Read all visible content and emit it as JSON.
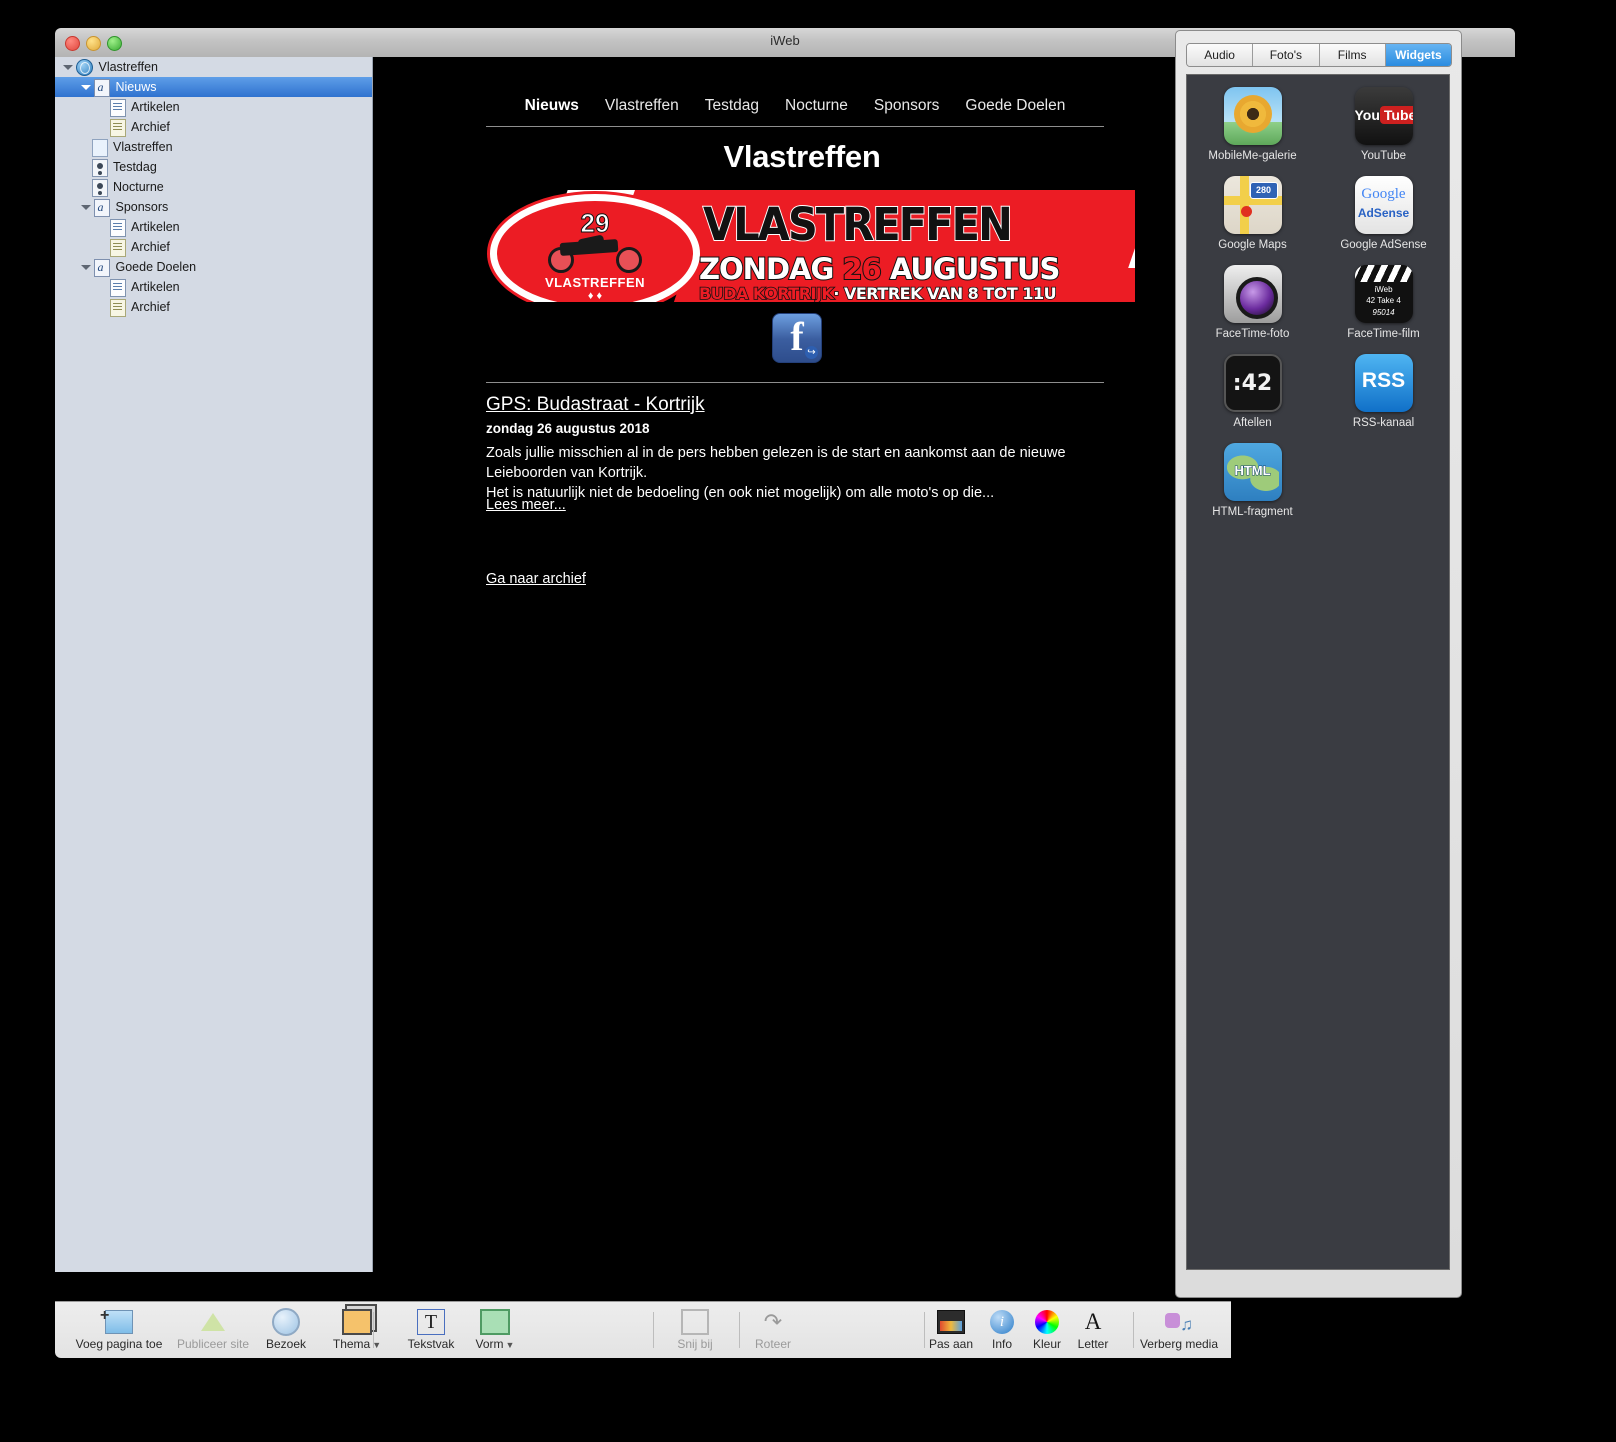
{
  "window": {
    "title": "iWeb",
    "traffic_lights": [
      "close-button",
      "minimize-button",
      "zoom-button"
    ]
  },
  "sidebar": {
    "items": [
      {
        "label": "Vlastreffen",
        "icon": "globe-icon",
        "depth": 0,
        "disclosure": "open",
        "selected": false
      },
      {
        "label": "Nieuws",
        "icon": "blog-icon",
        "depth": 1,
        "disclosure": "open",
        "selected": true
      },
      {
        "label": "Artikelen",
        "icon": "article-icon",
        "depth": 2,
        "disclosure": "",
        "selected": false
      },
      {
        "label": "Archief",
        "icon": "archive-icon",
        "depth": 2,
        "disclosure": "",
        "selected": false
      },
      {
        "label": "Vlastreffen",
        "icon": "page-icon",
        "depth": 1,
        "disclosure": "",
        "selected": false
      },
      {
        "label": "Testdag",
        "icon": "person-icon",
        "depth": 1,
        "disclosure": "",
        "selected": false
      },
      {
        "label": "Nocturne",
        "icon": "person-icon",
        "depth": 1,
        "disclosure": "",
        "selected": false
      },
      {
        "label": "Sponsors",
        "icon": "blog-icon",
        "depth": 1,
        "disclosure": "open",
        "selected": false
      },
      {
        "label": "Artikelen",
        "icon": "article-icon",
        "depth": 2,
        "disclosure": "",
        "selected": false
      },
      {
        "label": "Archief",
        "icon": "archive-icon",
        "depth": 2,
        "disclosure": "",
        "selected": false
      },
      {
        "label": "Goede Doelen",
        "icon": "blog-icon",
        "depth": 1,
        "disclosure": "open",
        "selected": false
      },
      {
        "label": "Artikelen",
        "icon": "article-icon",
        "depth": 2,
        "disclosure": "",
        "selected": false
      },
      {
        "label": "Archief",
        "icon": "archive-icon",
        "depth": 2,
        "disclosure": "",
        "selected": false
      }
    ]
  },
  "page": {
    "nav": [
      {
        "label": "Nieuws",
        "active": true
      },
      {
        "label": "Vlastreffen",
        "active": false
      },
      {
        "label": "Testdag",
        "active": false
      },
      {
        "label": "Nocturne",
        "active": false
      },
      {
        "label": "Sponsors",
        "active": false
      },
      {
        "label": "Goede Doelen",
        "active": false
      }
    ],
    "title": "Vlastreffen",
    "banner": {
      "edition_number": "29",
      "logo_label": "VLASTREFFEN",
      "headline": "VLASTREFFEN",
      "date_pre": "ZONDAG ",
      "date_num": "26",
      "date_post": " AUGUSTUS",
      "location_red": "BUDA KORTRIJK",
      "location_rest": "· VERTREK VAN 8 TOT 11U"
    },
    "social": {
      "facebook_label": "f"
    },
    "article": {
      "title": "GPS: Budastraat - Kortrijk",
      "date": "zondag 26 augustus 2018",
      "body_line1": "Zoals jullie misschien al in de pers hebben gelezen is de start en aankomst aan de nieuwe Leieboorden van Kortrijk.",
      "body_line2": "Het is natuurlijk niet de bedoeling (en ook niet mogelijk) om alle moto's op die...",
      "read_more": "Lees meer...",
      "archive_link": "Ga naar archief"
    }
  },
  "media_browser": {
    "tabs": [
      {
        "label": "Audio",
        "active": false
      },
      {
        "label": "Foto's",
        "active": false
      },
      {
        "label": "Films",
        "active": false
      },
      {
        "label": "Widgets",
        "active": true
      }
    ],
    "widgets": [
      {
        "label": "MobileMe-galerie",
        "icon": "mobileme-gallery-icon"
      },
      {
        "label": "YouTube",
        "icon": "youtube-icon",
        "brand_you": "You",
        "brand_tube": "Tube"
      },
      {
        "label": "Google Maps",
        "icon": "google-maps-icon",
        "route_number": "280"
      },
      {
        "label": "Google AdSense",
        "icon": "google-adsense-icon",
        "brand_top": "Google",
        "brand_bottom": "AdSense"
      },
      {
        "label": "FaceTime-foto",
        "icon": "facetime-photo-icon"
      },
      {
        "label": "FaceTime-film",
        "icon": "facetime-movie-icon",
        "slate_title": "iWeb",
        "slate_take": "42  Take 4",
        "slate_code": "95014"
      },
      {
        "label": "Aftellen",
        "icon": "countdown-icon",
        "display": ":42"
      },
      {
        "label": "RSS-kanaal",
        "icon": "rss-icon",
        "display": "RSS"
      },
      {
        "label": "HTML-fragment",
        "icon": "html-snippet-icon",
        "display": "HTML"
      }
    ]
  },
  "toolbar": {
    "items": [
      {
        "label": "Voeg pagina toe",
        "icon": "add-page-icon",
        "enabled": true,
        "menu": false
      },
      {
        "label": "Publiceer site",
        "icon": "publish-site-icon",
        "enabled": false,
        "menu": false
      },
      {
        "label": "Bezoek",
        "icon": "visit-site-icon",
        "enabled": true,
        "menu": false
      },
      {
        "label": "Thema",
        "icon": "theme-icon",
        "enabled": true,
        "menu": true
      },
      {
        "label": "Tekstvak",
        "icon": "text-box-icon",
        "enabled": true,
        "menu": false
      },
      {
        "label": "Vorm",
        "icon": "shape-icon",
        "enabled": true,
        "menu": true
      },
      {
        "label": "Snij bij",
        "icon": "crop-icon",
        "enabled": false,
        "menu": false
      },
      {
        "label": "Roteer",
        "icon": "rotate-icon",
        "enabled": false,
        "menu": false
      },
      {
        "label": "Pas aan",
        "icon": "adjust-image-icon",
        "enabled": true,
        "menu": false
      },
      {
        "label": "Info",
        "icon": "inspector-icon",
        "enabled": true,
        "menu": false
      },
      {
        "label": "Kleur",
        "icon": "colors-icon",
        "enabled": true,
        "menu": false
      },
      {
        "label": "Letter",
        "icon": "fonts-icon",
        "enabled": true,
        "menu": false
      },
      {
        "label": "Verberg media",
        "icon": "media-browser-icon",
        "enabled": true,
        "menu": false
      }
    ]
  },
  "colors": {
    "accent_blue": "#2f72cf",
    "brand_red": "#ec1c24",
    "canvas_black": "#000000",
    "sidebar_bg": "#d4dae4",
    "widget_panel_bg": "#3a3c42"
  }
}
